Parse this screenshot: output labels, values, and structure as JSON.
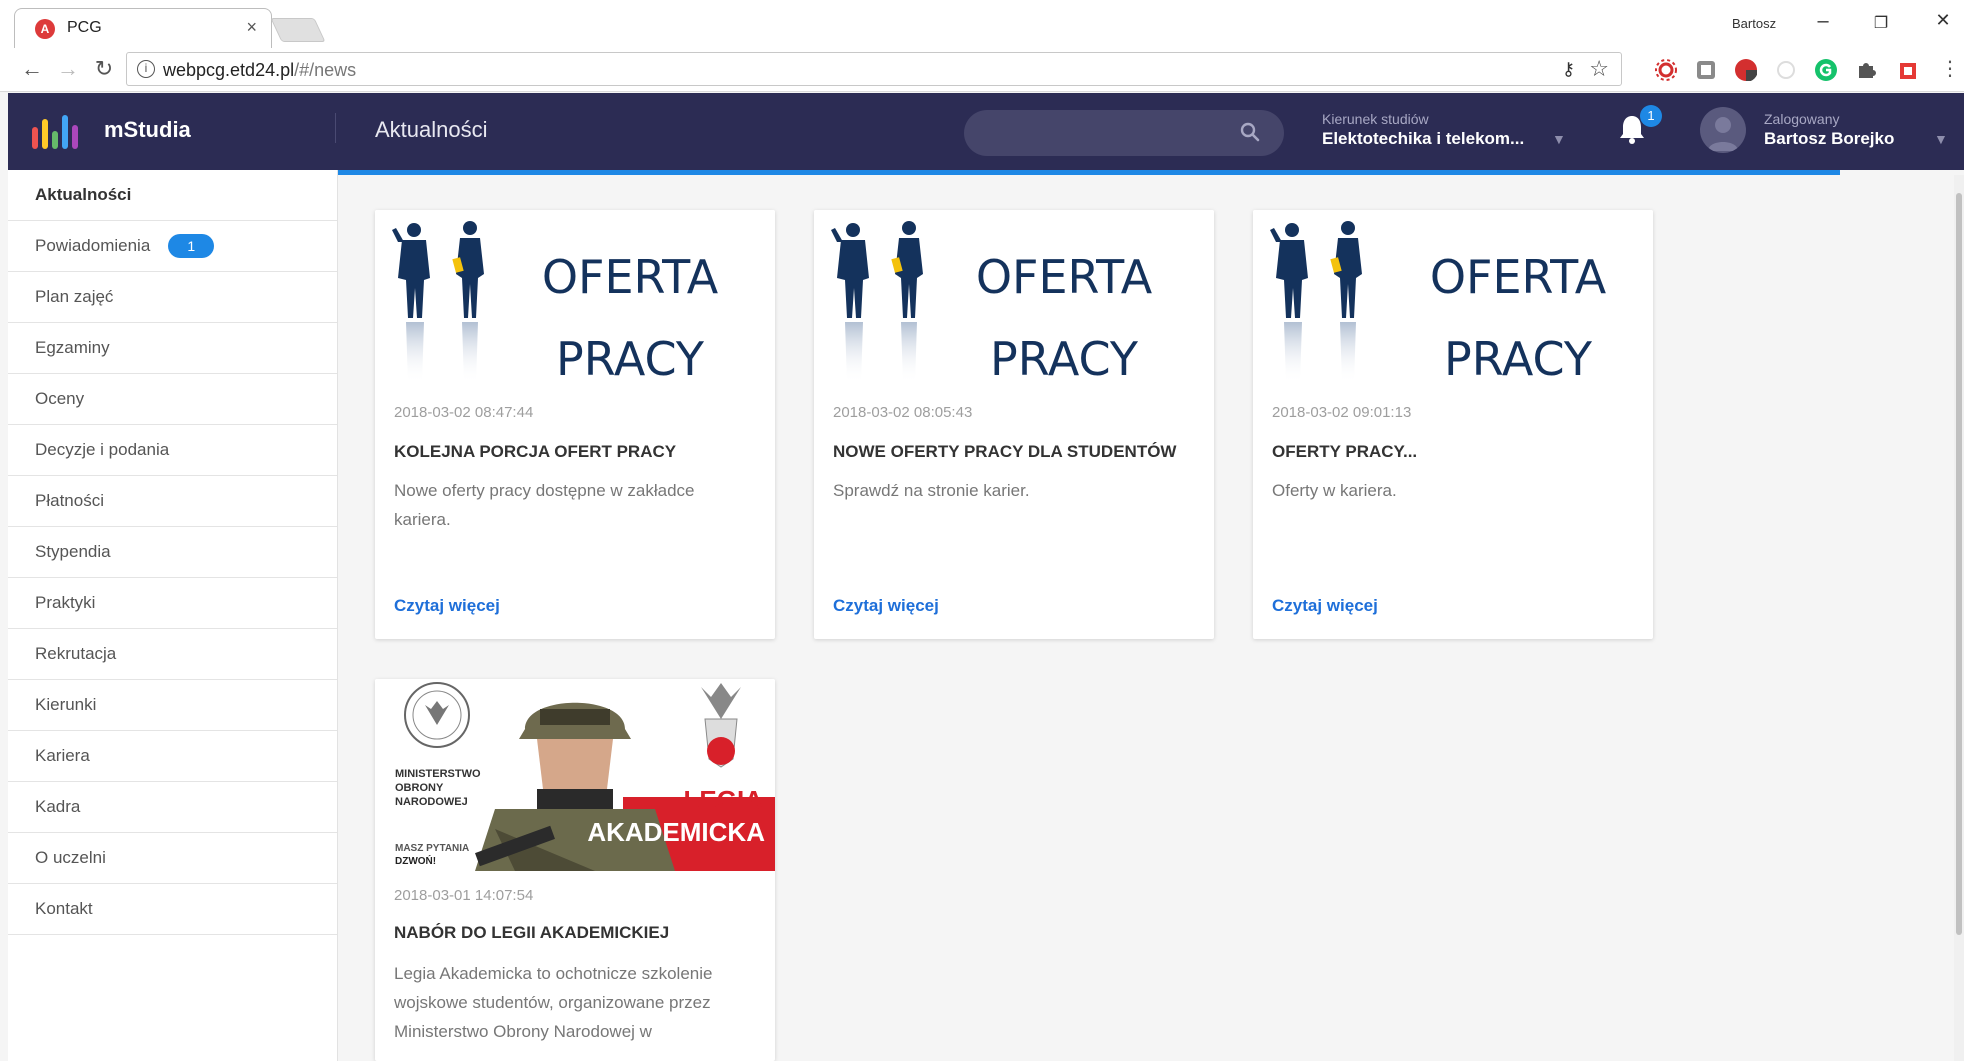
{
  "browser": {
    "tab_title": "PCG",
    "tab_close": "×",
    "url_host": "webpcg.etd24.pl",
    "url_path": "/#/news",
    "profile_name": "Bartosz",
    "min": "–",
    "restore": "❐",
    "close": "✕"
  },
  "header": {
    "brand": "mStudia",
    "page_title": "Aktualności",
    "study_label": "Kierunek studiów",
    "study_value": "Elektotechika i telekom...",
    "notifications_count": "1",
    "user_label": "Zalogowany",
    "user_value": "Bartosz Borejko"
  },
  "sidebar": {
    "items": [
      {
        "label": "Aktualności"
      },
      {
        "label": "Powiadomienia",
        "badge": "1"
      },
      {
        "label": "Plan zajęć"
      },
      {
        "label": "Egzaminy"
      },
      {
        "label": "Oceny"
      },
      {
        "label": "Decyzje i podania"
      },
      {
        "label": "Płatności"
      },
      {
        "label": "Stypendia"
      },
      {
        "label": "Praktyki"
      },
      {
        "label": "Rekrutacja"
      },
      {
        "label": "Kierunki"
      },
      {
        "label": "Kariera"
      },
      {
        "label": "Kadra"
      },
      {
        "label": "O uczelni"
      },
      {
        "label": "Kontakt"
      }
    ]
  },
  "news": [
    {
      "image_text_1": "OFERTA",
      "image_text_2": "PRACY",
      "date": "2018-03-02 08:47:44",
      "title": "KOLEJNA PORCJA OFERT PRACY",
      "text": "Nowe oferty pracy dostępne w zakładce kariera.",
      "link": "Czytaj więcej"
    },
    {
      "image_text_1": "OFERTA",
      "image_text_2": "PRACY",
      "date": "2018-03-02 08:05:43",
      "title": "NOWE OFERTY PRACY DLA STUDENTÓW",
      "text": "Sprawdź na stronie karier.",
      "link": "Czytaj więcej"
    },
    {
      "image_text_1": "OFERTA",
      "image_text_2": "PRACY",
      "date": "2018-03-02 09:01:13",
      "title": "OFERTY PRACY...",
      "text": "Oferty w kariera.",
      "link": "Czytaj więcej"
    },
    {
      "image_line_1": "MINISTERSTWO",
      "image_line_2": "OBRONY",
      "image_line_3": "NARODOWEJ",
      "image_big_1": "LEGIA",
      "image_big_2": "AKADEMICKA",
      "image_small_1": "MASZ PYTANIA",
      "image_small_2": "DZWOŃ!",
      "date": "2018-03-01 14:07:54",
      "title": "NABÓR DO LEGII AKADEMICKIEJ",
      "text": "Legia Akademicka to ochotnicze szkolenie wojskowe studentów, organizowane przez Ministerstwo Obrony Narodowej w"
    }
  ],
  "colors": {
    "header_bg": "#2c2c54",
    "accent": "#1e88e5",
    "link": "#1e6fd9"
  }
}
